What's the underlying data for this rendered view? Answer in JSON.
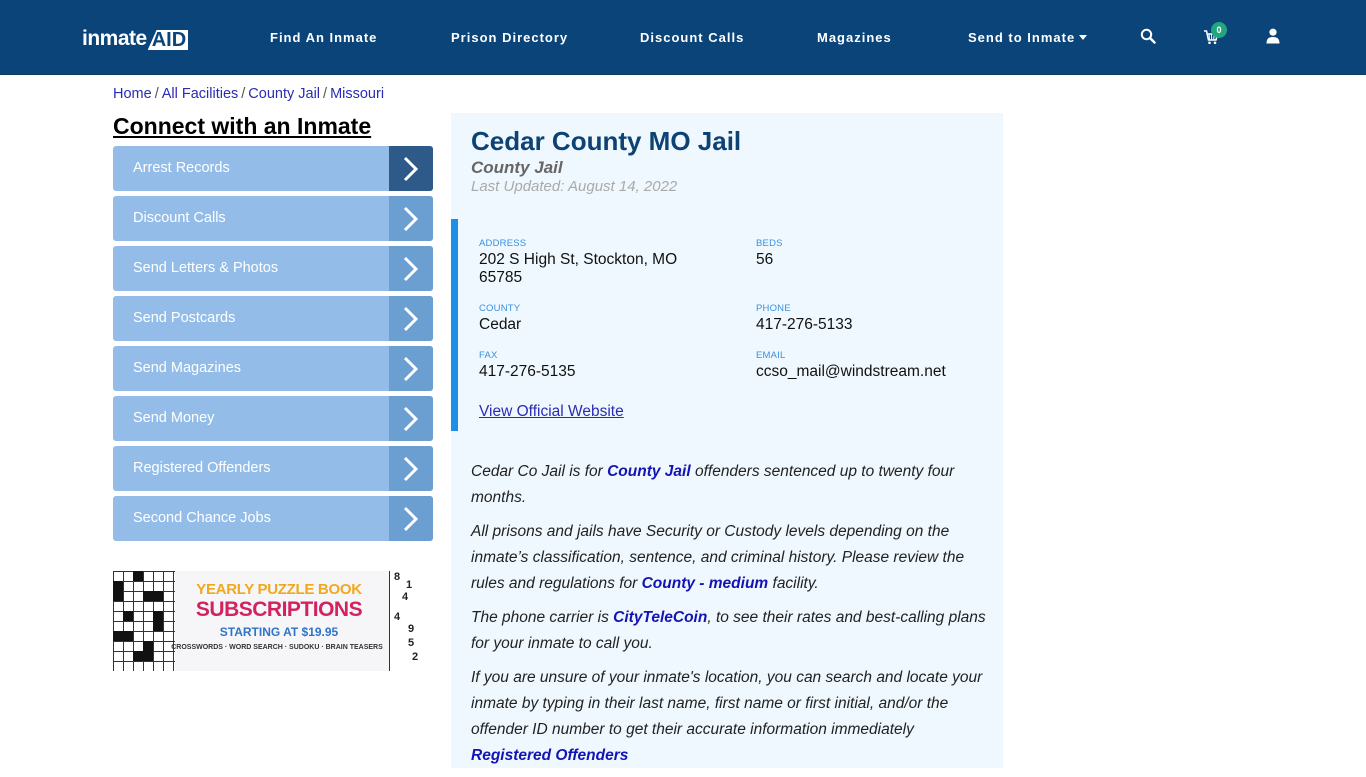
{
  "header": {
    "logo": {
      "text_left": "inmate",
      "text_right": "AID",
      "plus": "+"
    },
    "nav": [
      {
        "label": "Find An Inmate"
      },
      {
        "label": "Prison Directory"
      },
      {
        "label": "Discount Calls"
      },
      {
        "label": "Magazines"
      },
      {
        "label": "Send to Inmate"
      }
    ],
    "icons": {
      "search": "search-icon",
      "cart": "cart-icon",
      "user": "user-icon"
    },
    "cart_count": "0",
    "colors": {
      "bar": "#0b4479",
      "badge": "#22a67f"
    }
  },
  "breadcrumb": {
    "items": [
      {
        "label": "Home"
      },
      {
        "label": "All Facilities"
      },
      {
        "label": "County Jail"
      },
      {
        "label": "Missouri"
      }
    ],
    "separator": "/"
  },
  "sidebar": {
    "title": "Connect with an Inmate",
    "items": [
      {
        "label": "Arrest Records"
      },
      {
        "label": "Discount Calls"
      },
      {
        "label": "Send Letters & Photos"
      },
      {
        "label": "Send Postcards"
      },
      {
        "label": "Send Magazines"
      },
      {
        "label": "Send Money"
      },
      {
        "label": "Registered Offenders"
      },
      {
        "label": "Second Chance Jobs"
      }
    ],
    "ad": {
      "line1": "YEARLY PUZZLE BOOK",
      "line2": "SUBSCRIPTIONS",
      "line3": "STARTING AT $19.95",
      "line4": "CROSSWORDS · WORD SEARCH · SUDOKU · BRAIN TEASERS",
      "sudoku_digits": [
        "8",
        "1",
        "4",
        "4",
        "9",
        "5",
        "2"
      ]
    }
  },
  "facility": {
    "name": "Cedar County MO Jail",
    "type": "County Jail",
    "last_updated": "Last Updated: August 14, 2022",
    "fields": {
      "address": {
        "label": "ADDRESS",
        "line1": "202 S High St, Stockton, MO",
        "line2": "65785"
      },
      "beds": {
        "label": "BEDS",
        "value": "56"
      },
      "county": {
        "label": "COUNTY",
        "value": "Cedar"
      },
      "phone": {
        "label": "PHONE",
        "value": "417-276-5133"
      },
      "fax": {
        "label": "FAX",
        "value": "417-276-5135"
      },
      "email": {
        "label": "EMAIL",
        "value": "ccso_mail@windstream.net"
      }
    },
    "website_link": "View Official Website",
    "description": {
      "p1": {
        "before": "Cedar Co Jail is for ",
        "link": "County Jail",
        "after": " offenders sentenced up to twenty four months."
      },
      "p2": {
        "before": "All prisons and jails have Security or Custody levels depending on the inmate’s classification, sentence, and criminal history. Please review the rules and regulations for ",
        "link": "County - medium",
        "after": " facility."
      },
      "p3": {
        "before": "The phone carrier is ",
        "link": "CityTeleCoin",
        "after": ", to see their rates and best-calling plans for your inmate to call you."
      },
      "p4": {
        "before": "If you are unsure of your inmate's location, you can search and locate your inmate by typing in their last name, first name or first initial, and/or the offender ID number to get their accurate information immediately ",
        "link": "Registered Offenders"
      }
    }
  }
}
